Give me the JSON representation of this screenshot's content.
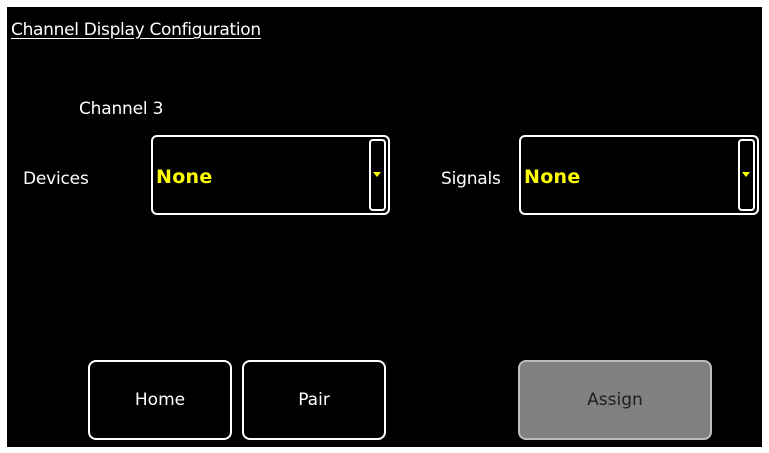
{
  "screen": {
    "title": "Channel Display Configuration",
    "channel_label": "Channel 3"
  },
  "devices": {
    "label": "Devices",
    "selected": "None"
  },
  "signals": {
    "label": "Signals",
    "selected": "None"
  },
  "buttons": {
    "home": "Home",
    "pair": "Pair",
    "assign": "Assign"
  },
  "colors": {
    "background": "#000000",
    "text": "#ffffff",
    "dropdown_value": "#ffff00",
    "assign_disabled_bg": "#808080"
  },
  "icons": {
    "dropdown_arrow": "chevron-down-icon"
  },
  "state": {
    "assign_enabled": false
  }
}
